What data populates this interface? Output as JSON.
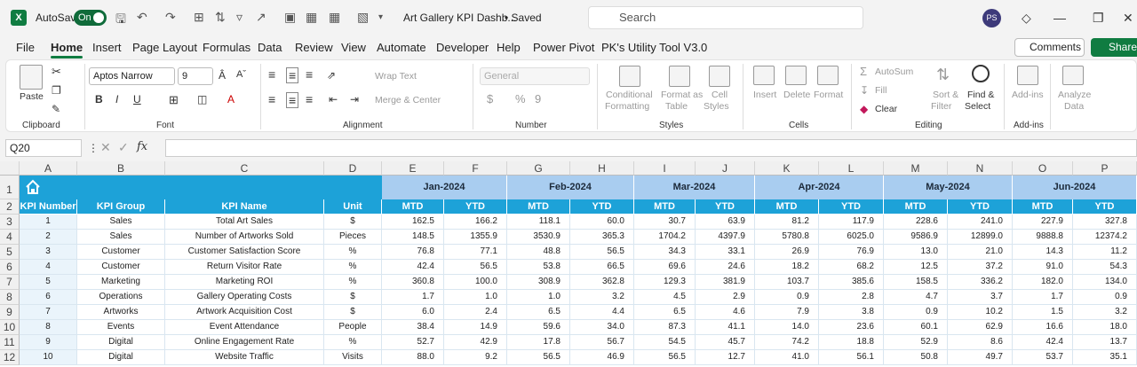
{
  "titlebar": {
    "app_logo": "X",
    "autosave_label": "AutoSave",
    "autosave_state": "On",
    "doc_title": "Art Gallery KPI Dashb...",
    "save_status": "• Saved",
    "search_placeholder": "Search",
    "avatar": "PS"
  },
  "tabs": [
    "File",
    "Home",
    "Insert",
    "Page Layout",
    "Formulas",
    "Data",
    "Review",
    "View",
    "Automate",
    "Developer",
    "Help",
    "Power Pivot",
    "PK's Utility Tool V3.0"
  ],
  "actions": {
    "comments": "Comments",
    "share": "Share"
  },
  "ribbon": {
    "clipboard": {
      "paste": "Paste",
      "label": "Clipboard"
    },
    "font": {
      "name": "Aptos Narrow",
      "size": "9",
      "label": "Font",
      "bold": "B",
      "italic": "I",
      "underline": "U"
    },
    "alignment": {
      "wrap": "Wrap Text",
      "merge": "Merge & Center",
      "label": "Alignment"
    },
    "number": {
      "format": "General",
      "dollar": "$",
      "percent": "%",
      "comma": "9",
      "label": "Number"
    },
    "styles": {
      "conditional": "Conditional",
      "conditional2": "Formatting",
      "format_as": "Format as",
      "format_as2": "Table",
      "cell": "Cell",
      "cell2": "Styles",
      "label": "Styles"
    },
    "cells": {
      "insert": "Insert",
      "delete": "Delete",
      "format": "Format",
      "label": "Cells"
    },
    "editing": {
      "autosum": "AutoSum",
      "fill": "Fill",
      "clear": "Clear",
      "sort": "Sort &",
      "sort2": "Filter",
      "find": "Find &",
      "find2": "Select",
      "label": "Editing"
    },
    "addins": {
      "addins": "Add-ins",
      "label": "Add-ins"
    },
    "analyze": {
      "l1": "Analyze",
      "l2": "Data"
    }
  },
  "formula_bar": {
    "name_box": "Q20",
    "fx": "fx",
    "formula": ""
  },
  "sheet": {
    "columns": [
      "A",
      "B",
      "C",
      "D",
      "E",
      "F",
      "G",
      "H",
      "I",
      "J",
      "K",
      "L",
      "M",
      "N",
      "O",
      "P"
    ],
    "rows": [
      "1",
      "2",
      "3",
      "4",
      "5",
      "6",
      "7",
      "8",
      "9",
      "10",
      "11",
      "12"
    ],
    "months": [
      "Jan-2024",
      "Feb-2024",
      "Mar-2024",
      "Apr-2024",
      "May-2024",
      "Jun-2024"
    ],
    "headers": [
      "KPI Number",
      "KPI Group",
      "KPI Name",
      "Unit",
      "MTD",
      "YTD",
      "MTD",
      "YTD",
      "MTD",
      "YTD",
      "MTD",
      "YTD",
      "MTD",
      "YTD",
      "MTD",
      "YTD"
    ],
    "data": [
      [
        "1",
        "Sales",
        "Total Art Sales",
        "$",
        "162.5",
        "166.2",
        "118.1",
        "60.0",
        "30.7",
        "63.9",
        "81.2",
        "117.9",
        "228.6",
        "241.0",
        "227.9",
        "327.8"
      ],
      [
        "2",
        "Sales",
        "Number of Artworks Sold",
        "Pieces",
        "148.5",
        "1355.9",
        "3530.9",
        "365.3",
        "1704.2",
        "4397.9",
        "5780.8",
        "6025.0",
        "9586.9",
        "12899.0",
        "9888.8",
        "12374.2"
      ],
      [
        "3",
        "Customer",
        "Customer Satisfaction Score",
        "%",
        "76.8",
        "77.1",
        "48.8",
        "56.5",
        "34.3",
        "33.1",
        "26.9",
        "76.9",
        "13.0",
        "21.0",
        "14.3",
        "11.2"
      ],
      [
        "4",
        "Customer",
        "Return Visitor Rate",
        "%",
        "42.4",
        "56.5",
        "53.8",
        "66.5",
        "69.6",
        "24.6",
        "18.2",
        "68.2",
        "12.5",
        "37.2",
        "91.0",
        "54.3"
      ],
      [
        "5",
        "Marketing",
        "Marketing ROI",
        "%",
        "360.8",
        "100.0",
        "308.9",
        "362.8",
        "129.3",
        "381.9",
        "103.7",
        "385.6",
        "158.5",
        "336.2",
        "182.0",
        "134.0"
      ],
      [
        "6",
        "Operations",
        "Gallery Operating Costs",
        "$",
        "1.7",
        "1.0",
        "1.0",
        "3.2",
        "4.5",
        "2.9",
        "0.9",
        "2.8",
        "4.7",
        "3.7",
        "1.7",
        "0.9"
      ],
      [
        "7",
        "Artworks",
        "Artwork Acquisition Cost",
        "$",
        "6.0",
        "2.4",
        "6.5",
        "4.4",
        "6.5",
        "4.6",
        "7.9",
        "3.8",
        "0.9",
        "10.2",
        "1.5",
        "3.2"
      ],
      [
        "8",
        "Events",
        "Event Attendance",
        "People",
        "38.4",
        "14.9",
        "59.6",
        "34.0",
        "87.3",
        "41.1",
        "14.0",
        "23.6",
        "60.1",
        "62.9",
        "16.6",
        "18.0"
      ],
      [
        "9",
        "Digital",
        "Online Engagement Rate",
        "%",
        "52.7",
        "42.9",
        "17.8",
        "56.7",
        "54.5",
        "45.7",
        "74.2",
        "18.8",
        "52.9",
        "8.6",
        "42.4",
        "13.7"
      ],
      [
        "10",
        "Digital",
        "Website Traffic",
        "Visits",
        "88.0",
        "9.2",
        "56.5",
        "46.9",
        "56.5",
        "12.7",
        "41.0",
        "56.1",
        "50.8",
        "49.7",
        "53.7",
        "35.1"
      ]
    ]
  },
  "colors": {
    "header_blue": "#1da2d8",
    "month_blue": "#a9cdf0",
    "excel_green": "#107c41"
  }
}
